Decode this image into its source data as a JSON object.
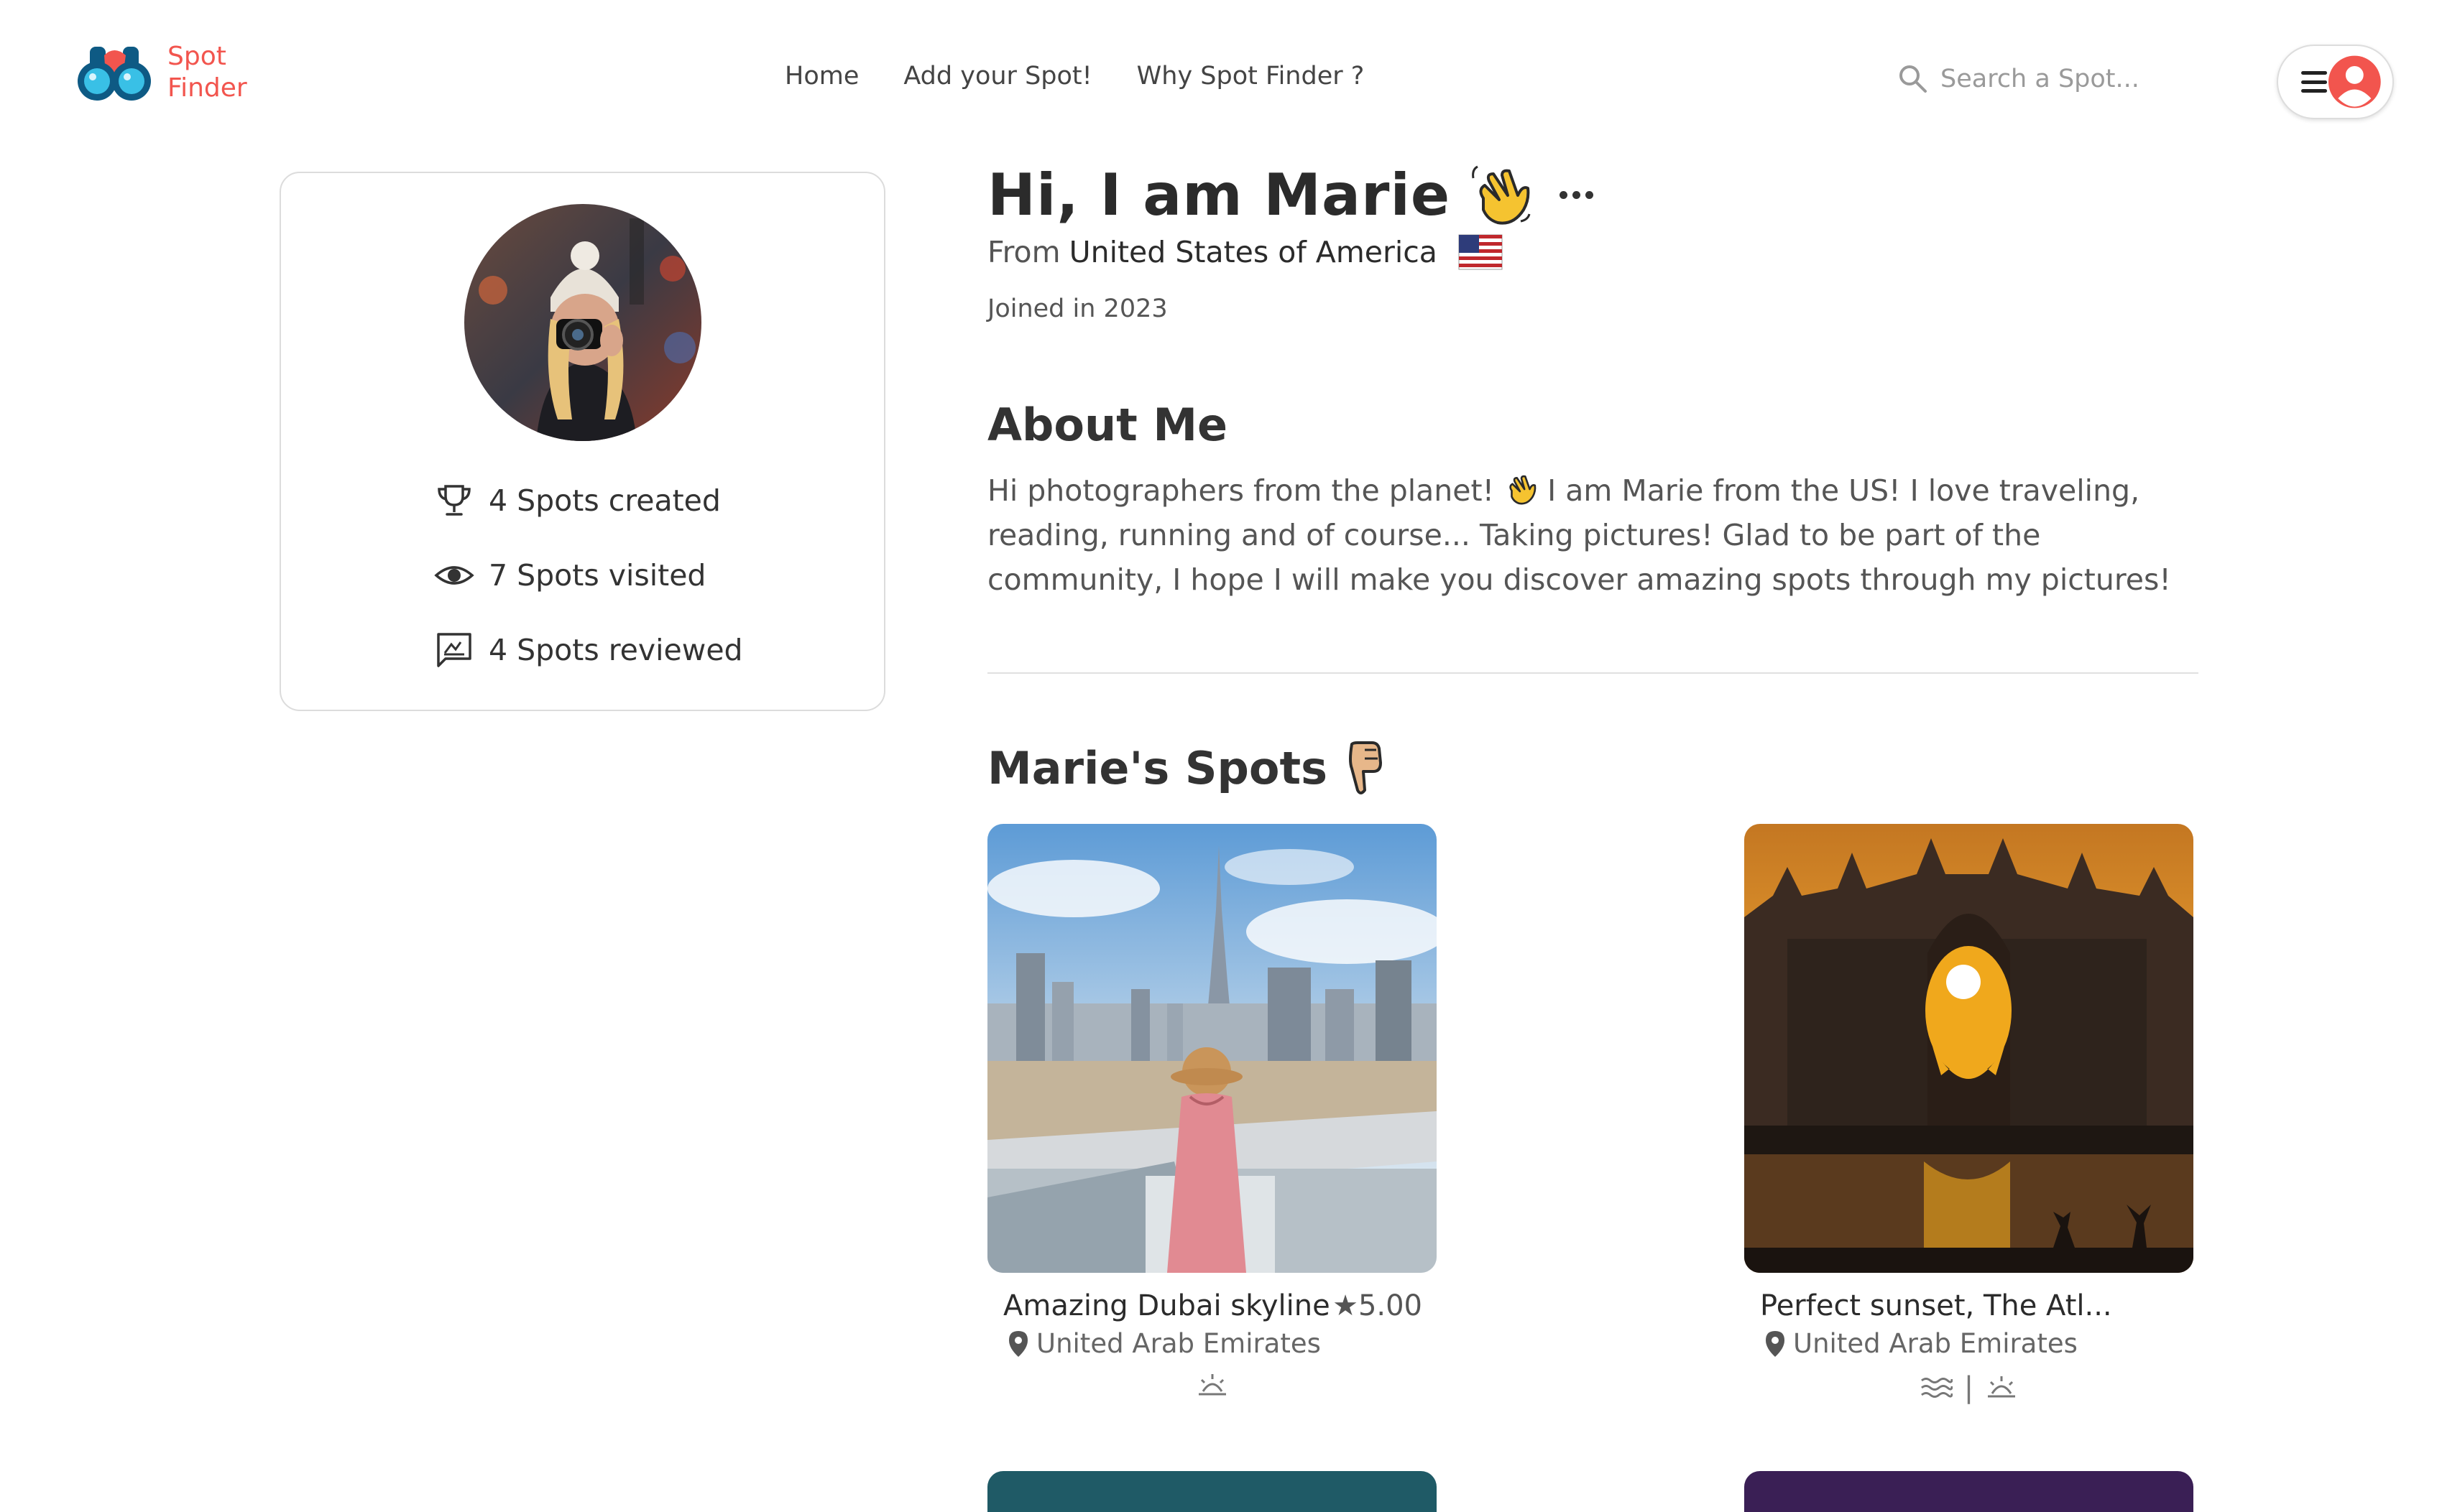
{
  "header": {
    "logo_line1": "Spot",
    "logo_line2": "Finder",
    "nav": [
      "Home",
      "Add your Spot!",
      "Why Spot Finder ?"
    ],
    "search_placeholder": "Search a Spot...",
    "icons": [
      "binoculars-logo-icon",
      "search-icon",
      "menu-icon",
      "user-icon"
    ],
    "accent_color": "#f2554e"
  },
  "profile_card": {
    "stats": [
      {
        "icon": "trophy-icon",
        "label": "4 Spots created"
      },
      {
        "icon": "eye-icon",
        "label": "7 Spots visited"
      },
      {
        "icon": "review-icon",
        "label": "4 Spots reviewed"
      }
    ]
  },
  "profile": {
    "greeting": "Hi, I am Marie",
    "from_label": "From",
    "country": "United States of America",
    "joined": "Joined in 2023"
  },
  "about": {
    "title": "About Me",
    "text_before_emoji": "Hi photographers from the planet!",
    "text_after_emoji": "I am Marie from the US! I love traveling, reading, running and of course... Taking pictures! Glad to be part of the community, I hope I will make you discover amazing spots through my pictures!"
  },
  "spots_section": {
    "title": "Marie's Spots",
    "spots": [
      {
        "name": "Amazing Dubai skyline",
        "rating": "★5.00",
        "location": "United Arab Emirates",
        "tags": [
          "sunrise-icon"
        ]
      },
      {
        "name": "Perfect sunset, The Atl...",
        "rating": "",
        "location": "United Arab Emirates",
        "tags": [
          "water-icon",
          "sunrise-icon"
        ],
        "separator": "|"
      }
    ]
  }
}
